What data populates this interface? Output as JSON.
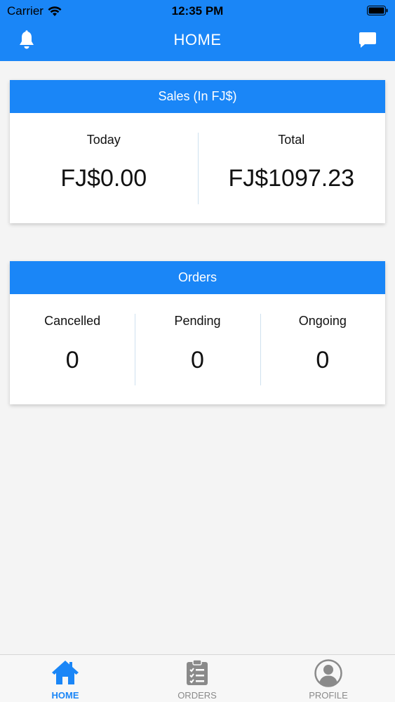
{
  "status": {
    "carrier": "Carrier",
    "time": "12:35 PM"
  },
  "nav": {
    "title": "HOME"
  },
  "sales": {
    "header": "Sales (In FJ$)",
    "today_label": "Today",
    "today_value": "FJ$0.00",
    "total_label": "Total",
    "total_value": "FJ$1097.23"
  },
  "orders": {
    "header": "Orders",
    "cancelled_label": "Cancelled",
    "cancelled_value": "0",
    "pending_label": "Pending",
    "pending_value": "0",
    "ongoing_label": "Ongoing",
    "ongoing_value": "0"
  },
  "tabs": {
    "home": "HOME",
    "orders": "ORDERS",
    "profile": "PROFILE"
  },
  "colors": {
    "primary": "#1a86f7",
    "inactive": "#8a8a8a"
  },
  "icons": [
    "wifi-icon",
    "battery-icon",
    "bell-icon",
    "chat-icon",
    "home-icon",
    "clipboard-list-icon",
    "user-circle-icon"
  ]
}
